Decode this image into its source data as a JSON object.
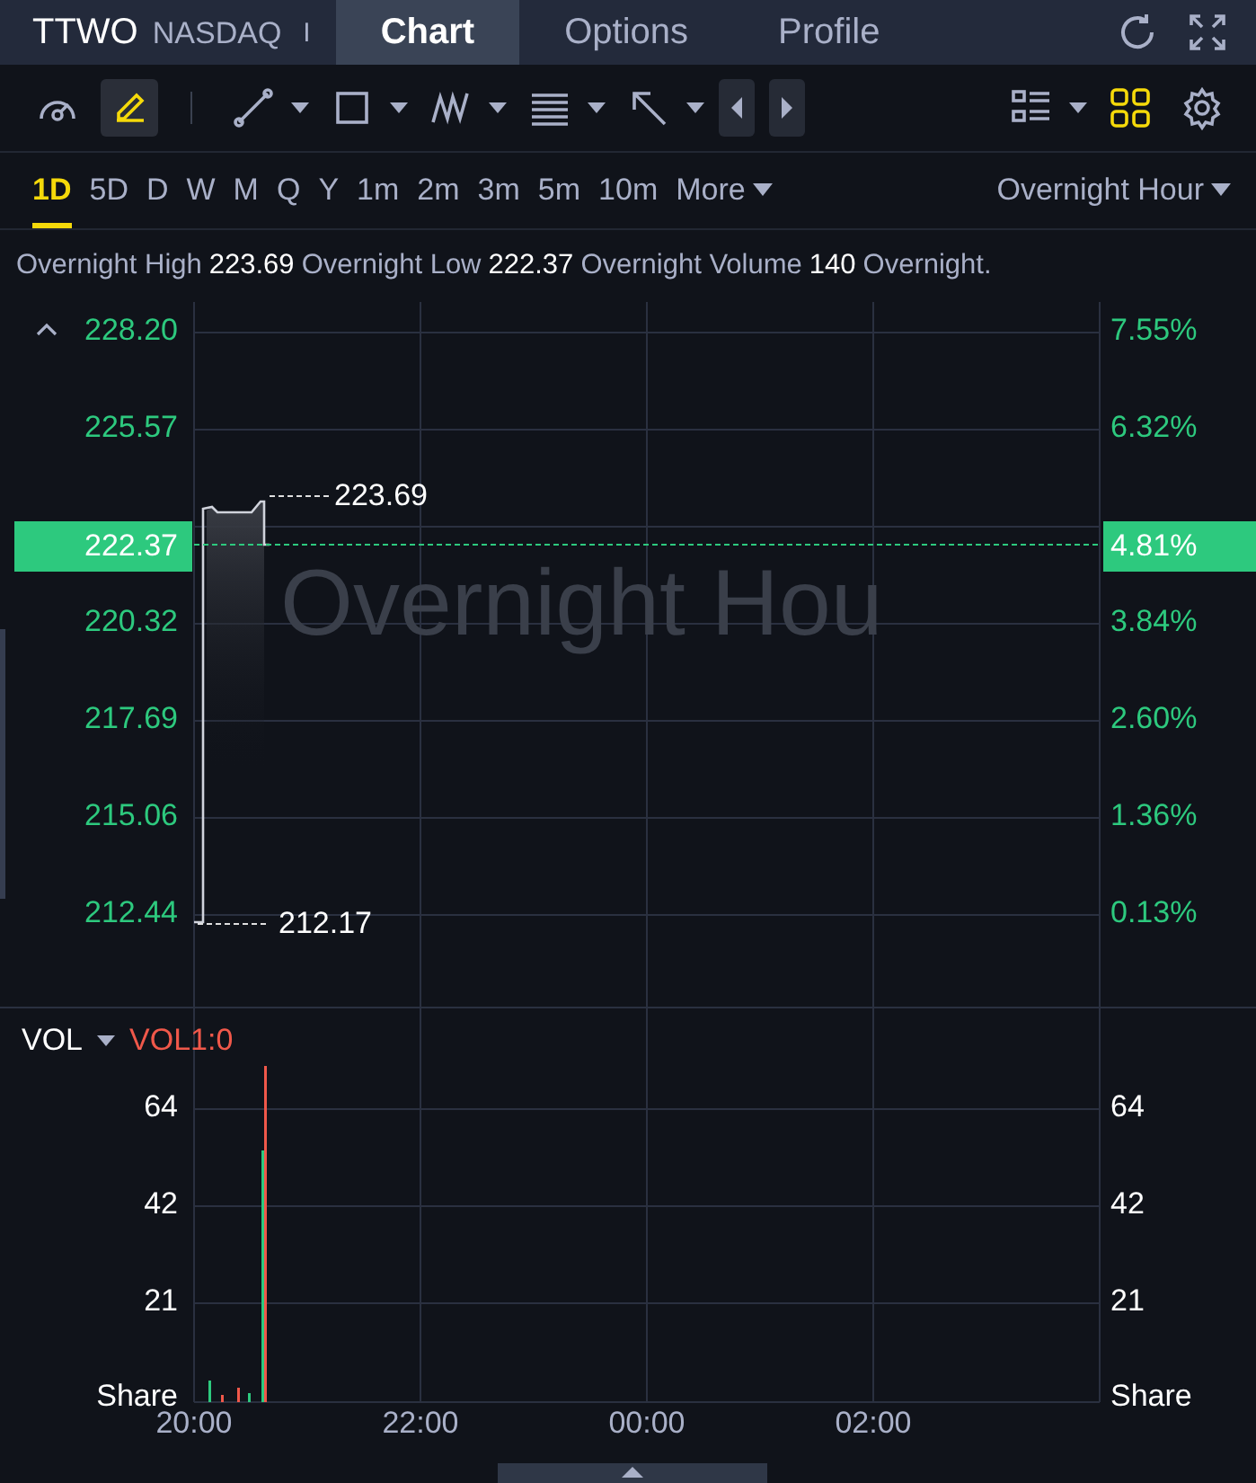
{
  "header": {
    "symbol": "TTWO",
    "exchange": "NASDAQ",
    "separator": "I",
    "tabs": [
      {
        "label": "Chart",
        "selected": true
      },
      {
        "label": "Options",
        "selected": false
      },
      {
        "label": "Profile",
        "selected": false
      }
    ]
  },
  "toolbar": {
    "left_tools": [
      {
        "kind": "gauge",
        "selected": false
      },
      {
        "kind": "pencil",
        "selected": true,
        "highlighted": true
      }
    ],
    "draw_tools": [
      {
        "kind": "line",
        "selected": false,
        "dropdown": true
      },
      {
        "kind": "rectangle",
        "selected": false,
        "dropdown": true
      },
      {
        "kind": "pattern",
        "selected": false,
        "dropdown": true
      },
      {
        "kind": "text",
        "selected": false,
        "dropdown": true
      },
      {
        "kind": "arrow",
        "selected": false,
        "dropdown": true
      }
    ],
    "view_tools": [
      {
        "kind": "list",
        "selected": false,
        "dropdown": true
      },
      {
        "kind": "grid",
        "selected": true
      },
      {
        "kind": "gear",
        "selected": false
      }
    ]
  },
  "timeframes": [
    {
      "label": "1D",
      "selected": true
    },
    {
      "label": "5D",
      "selected": false
    },
    {
      "label": "D",
      "selected": false
    },
    {
      "label": "W",
      "selected": false
    },
    {
      "label": "M",
      "selected": false
    },
    {
      "label": "Q",
      "selected": false
    },
    {
      "label": "Y",
      "selected": false
    },
    {
      "label": "1m",
      "selected": false
    },
    {
      "label": "2m",
      "selected": false
    },
    {
      "label": "3m",
      "selected": false
    },
    {
      "label": "5m",
      "selected": false
    },
    {
      "label": "10m",
      "selected": false
    }
  ],
  "more": "More",
  "session": "Overnight Hour",
  "stats": [
    {
      "label": "Overnight High",
      "value": "223.69"
    },
    {
      "label": "Overnight Low",
      "value": "222.37"
    },
    {
      "label": "Overnight Volume",
      "value": "140"
    },
    {
      "label": "Overnight."
    }
  ],
  "price_chart": {
    "left_ticks": [
      "228.20",
      "225.57",
      "220.32",
      "217.69",
      "215.06",
      "212.44"
    ],
    "right_ticks": [
      "7.55%",
      "6.32%",
      "3.84%",
      "2.60%",
      "1.36%",
      "0.13%"
    ],
    "current_price": "222.37",
    "current_change": "4.81%",
    "high_label": "223.69",
    "low_label": "212.17",
    "watermark": "Overnight Hou"
  },
  "volume": {
    "title": "VOL",
    "indicator": "VOL1:0",
    "left_ticks": [
      "64",
      "42",
      "21"
    ],
    "right_ticks": [
      "64",
      "42",
      "21"
    ],
    "left_unit": "Share",
    "right_unit": "Share",
    "x_labels": [
      "20:00",
      "22:00",
      "00:00",
      "02:00"
    ]
  }
}
